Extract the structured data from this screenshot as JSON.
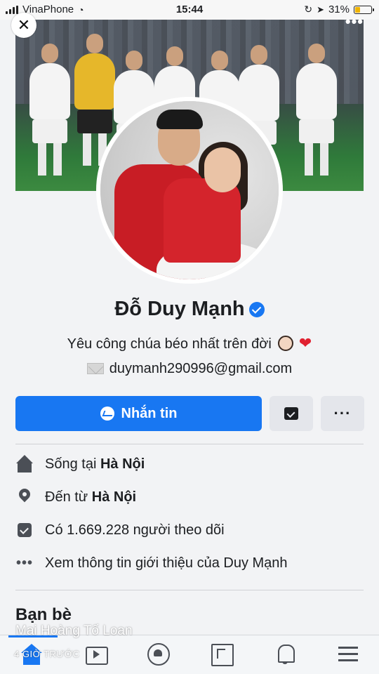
{
  "status_bar": {
    "carrier": "VinaPhone",
    "time": "15:44",
    "battery": "31%",
    "battery_level": 0.31
  },
  "profile": {
    "name": "Đỗ Duy Mạnh",
    "bio": "Yêu công chúa béo nhất trên đời",
    "email": "duymanh290996@gmail.com",
    "verified": true
  },
  "actions": {
    "message_label": "Nhắn tin",
    "more_label": "···"
  },
  "info": {
    "lives_prefix": "Sống tại",
    "lives_place": "Hà Nội",
    "from_prefix": "Đến từ",
    "from_place": "Hà Nội",
    "followers_text": "Có 1.669.228 người theo dõi",
    "about_text": "Xem thông tin giới thiệu của Duy Mạnh"
  },
  "friends": {
    "title": "Bạn bè"
  },
  "overlay": {
    "name": "Mai Hoàng Tố Loan",
    "time": "4 GIỜ TRƯỚC"
  },
  "colors": {
    "accent": "#1877f2",
    "secondary_button": "#e4e6eb",
    "background": "#f2f3f5"
  },
  "icons": {
    "close": "close-icon",
    "more": "more-icon",
    "messenger": "messenger-icon",
    "follow": "follow-icon",
    "home": "home-icon",
    "location": "location-pin-icon",
    "followers": "followers-icon",
    "about": "dots-icon"
  }
}
